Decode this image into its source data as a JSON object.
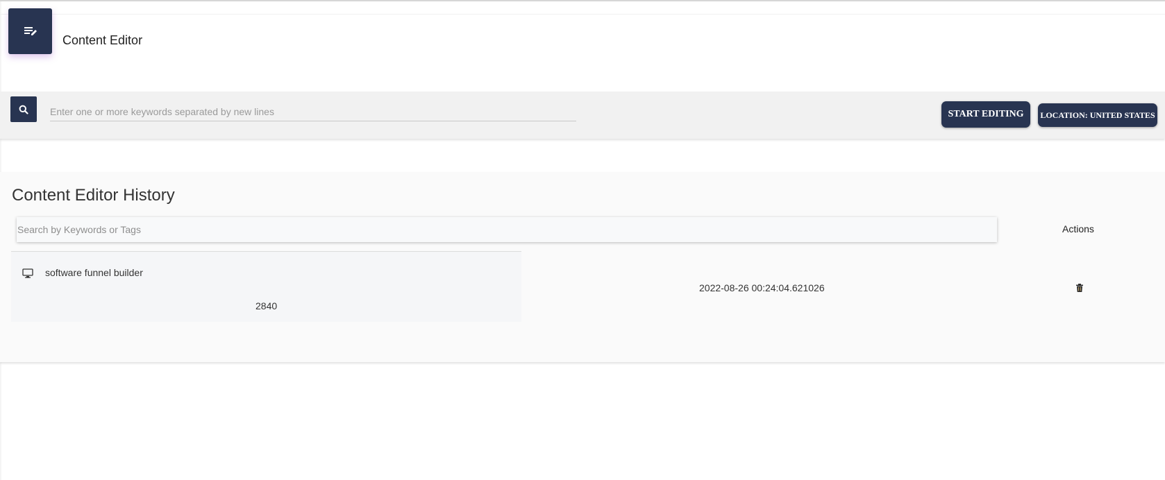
{
  "header": {
    "title": "Content Editor",
    "icon": "edit-list-icon"
  },
  "search": {
    "placeholder": "Enter one or more keywords separated by new lines",
    "value": "",
    "button_icon": "search-icon",
    "start_label": "START EDITING",
    "location_label": "LOCATION: UNITED STATES"
  },
  "history": {
    "title": "Content Editor History",
    "search_placeholder": "Search by Keywords or Tags",
    "actions_label": "Actions",
    "rows": [
      {
        "device_icon": "monitor-icon",
        "keyword": "software funnel builder",
        "count": "2840",
        "date": "2022-08-26 00:24:04.621026",
        "action_icon": "trash-icon"
      }
    ]
  },
  "colors": {
    "primary": "#283451",
    "panel": "#f1f1f1",
    "history_bg": "#fafafa"
  }
}
